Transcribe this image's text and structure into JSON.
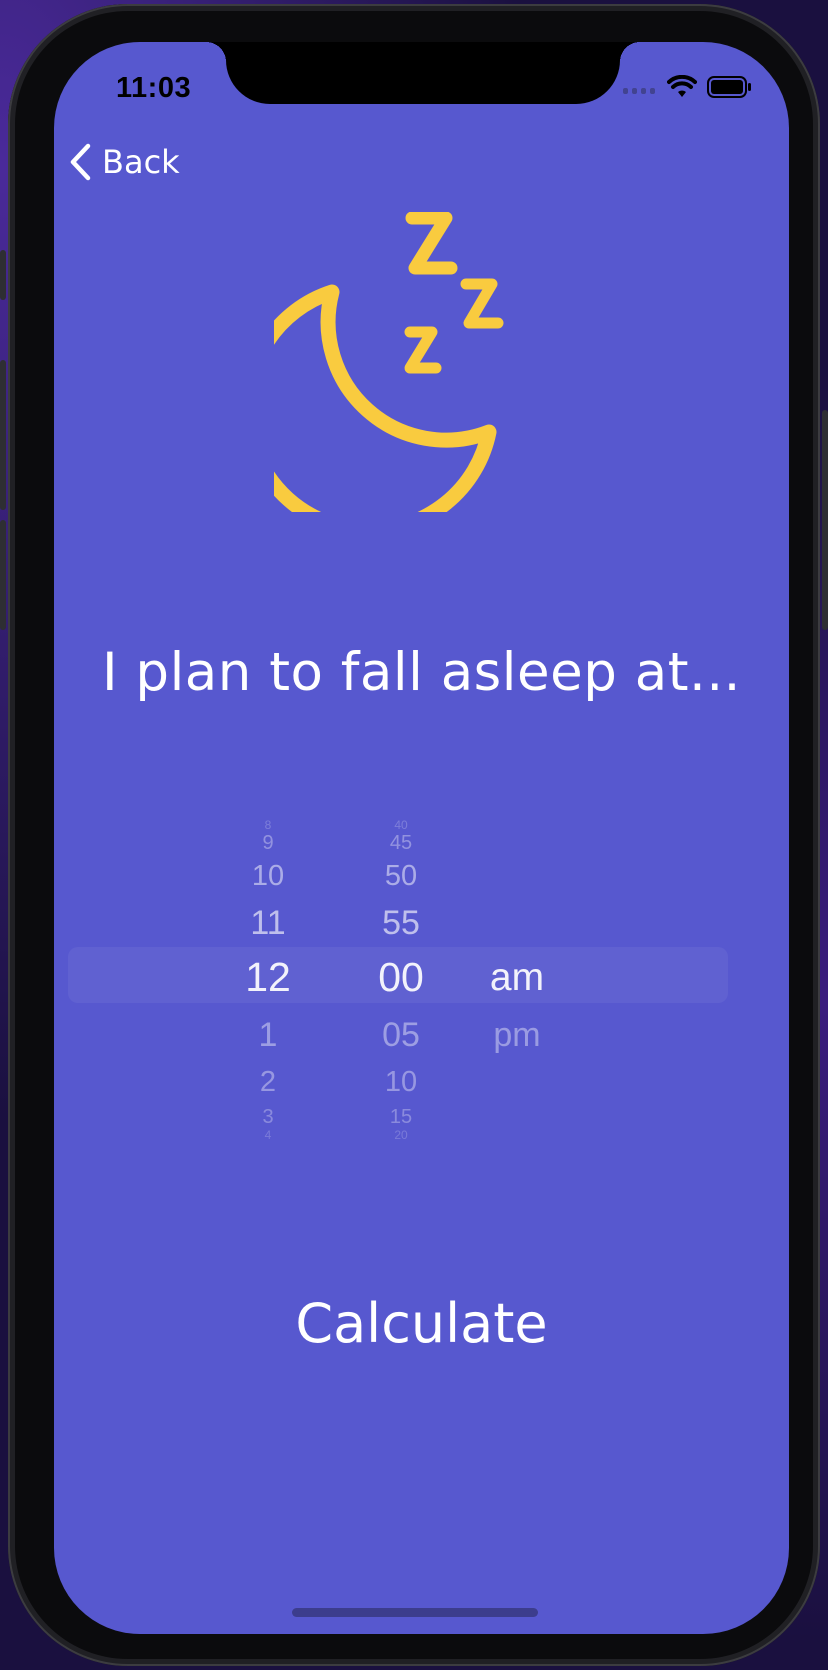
{
  "colors": {
    "screen_bg": "#5758cf",
    "accent": "#f9cb3f",
    "text": "#ffffff"
  },
  "status_bar": {
    "time": "11:03",
    "icons": [
      "signal-icon",
      "wifi-icon",
      "battery-icon"
    ]
  },
  "nav": {
    "back_label": "Back",
    "back_icon": "chevron-left-icon"
  },
  "hero": {
    "icon": "moon-zzz-icon"
  },
  "headline": "I plan to fall asleep at...",
  "picker": {
    "hour": {
      "above": [
        "8",
        "9",
        "10",
        "11"
      ],
      "selected": "12",
      "below": [
        "1",
        "2",
        "3",
        "4"
      ]
    },
    "minute": {
      "above": [
        "40",
        "45",
        "50",
        "55"
      ],
      "selected": "00",
      "below": [
        "05",
        "10",
        "15",
        "20"
      ]
    },
    "period": {
      "above": [],
      "selected": "am",
      "below": [
        "pm"
      ]
    }
  },
  "calculate_label": "Calculate"
}
